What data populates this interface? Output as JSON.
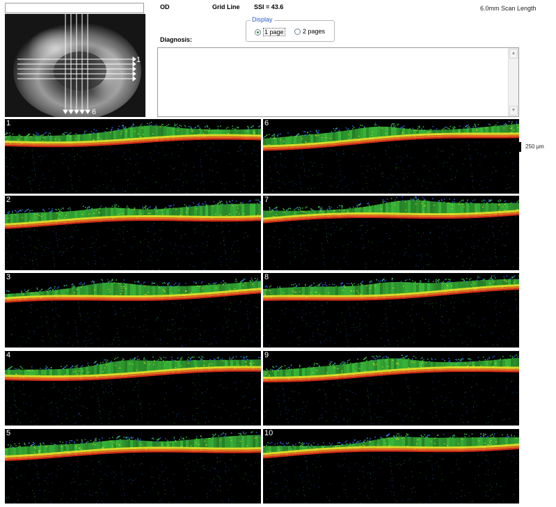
{
  "header": {
    "eye": "OD",
    "protocol_label": "Grid Line",
    "ssi": "SSI = 43.6",
    "scan_length": "6.0mm Scan Length"
  },
  "display": {
    "legend": "Display",
    "options": [
      {
        "label": "1 page",
        "selected": true
      },
      {
        "label": "2 pages",
        "selected": false
      }
    ]
  },
  "diagnosis": {
    "label": "Diagnosis:",
    "value": ""
  },
  "fundus": {
    "first_line_label": "1",
    "last_line_label": "6"
  },
  "scale": {
    "label": "250 µm"
  },
  "scans": [
    {
      "label": "1"
    },
    {
      "label": "6"
    },
    {
      "label": "2"
    },
    {
      "label": "7"
    },
    {
      "label": "3"
    },
    {
      "label": "8"
    },
    {
      "label": "4"
    },
    {
      "label": "9"
    },
    {
      "label": "5"
    },
    {
      "label": "10"
    }
  ],
  "colors": {
    "oct_background": "#000000",
    "oct_green": "#3bc03b",
    "oct_yellow": "#d8dc2a",
    "oct_orange": "#e07020",
    "oct_red": "#d42a1a",
    "oct_blue": "#2a6ad8",
    "radio_selected": "#2b8a2b",
    "display_legend": "#2c5cc5"
  }
}
